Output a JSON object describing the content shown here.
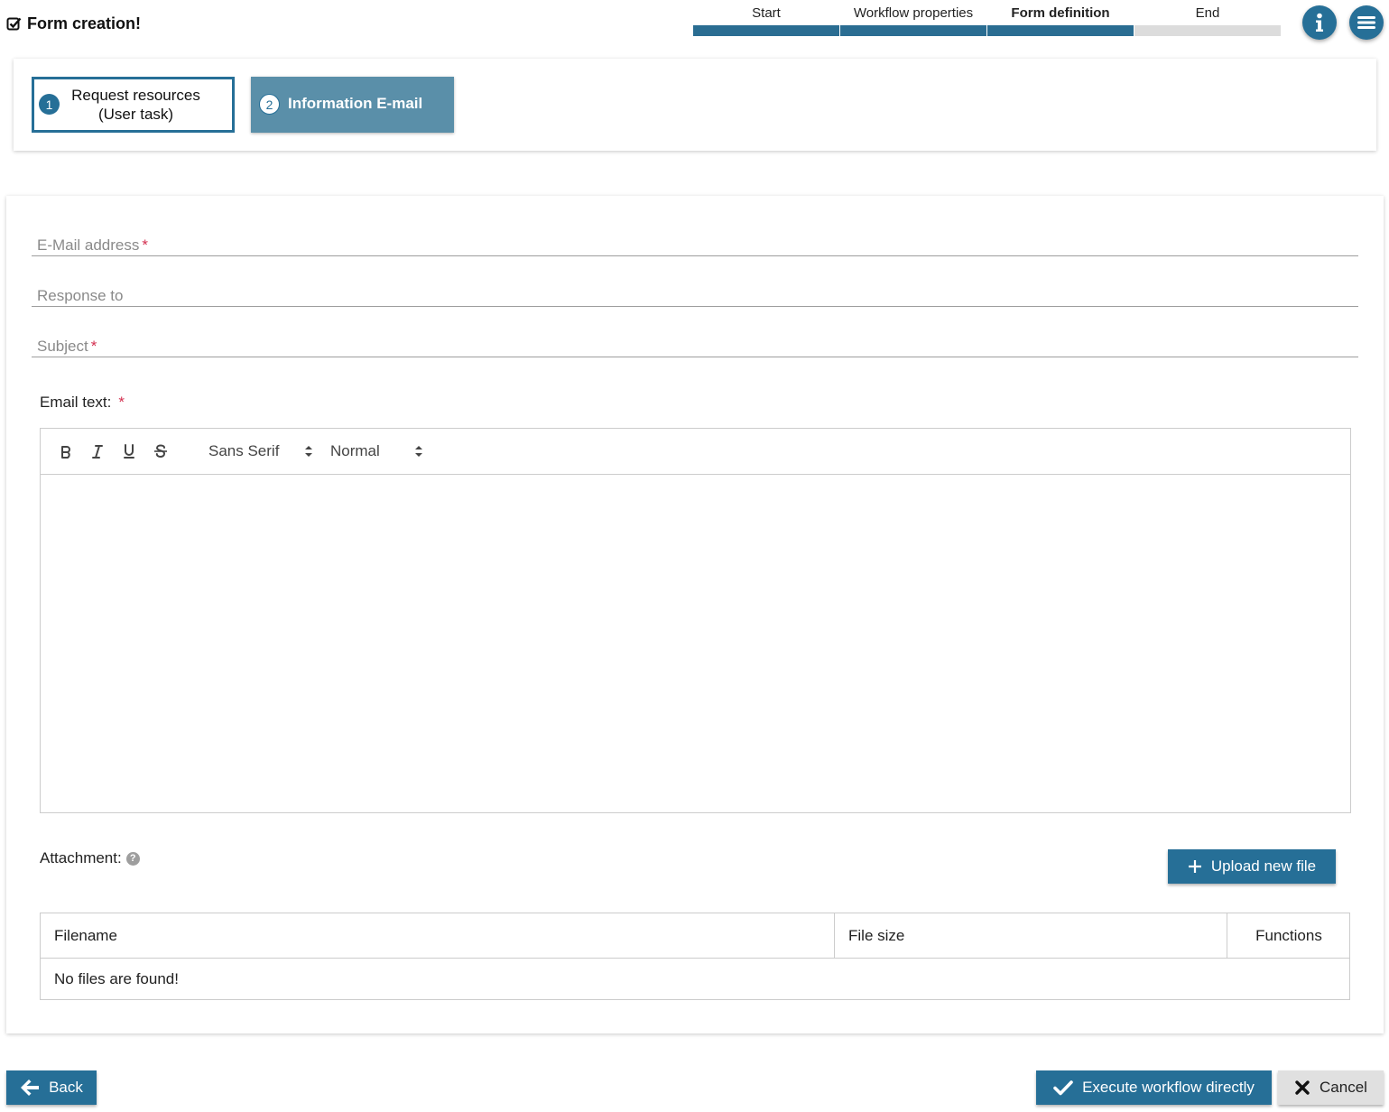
{
  "header": {
    "title": "Form creation!",
    "title_icon": "checkbox-icon",
    "steps": [
      {
        "label": "Start",
        "state": "done"
      },
      {
        "label": "Workflow properties",
        "state": "done"
      },
      {
        "label": "Form definition",
        "state": "current"
      },
      {
        "label": "End",
        "state": "todo"
      }
    ],
    "info_icon": "info-icon",
    "menu_icon": "menu-icon"
  },
  "tasks": [
    {
      "number": "1",
      "label": "Request resources (User task)",
      "line1": "Request resources",
      "line2": "(User task)",
      "selected": false
    },
    {
      "number": "2",
      "label": "Information E-mail",
      "selected": true
    }
  ],
  "form": {
    "email_address": {
      "label": "E-Mail address",
      "required_mark": "*",
      "value": ""
    },
    "response_to": {
      "label": "Response to",
      "value": ""
    },
    "subject": {
      "label": "Subject",
      "required_mark": "*",
      "value": ""
    },
    "email_text": {
      "label": "Email text:",
      "required_mark": "*",
      "toolbar": {
        "bold": "B",
        "italic": "I",
        "underline": "U",
        "strike": "S",
        "font": "Sans Serif",
        "size": "Normal"
      },
      "body": ""
    },
    "attachment": {
      "label": "Attachment:",
      "help": "?",
      "upload_label": "Upload new file",
      "columns": [
        "Filename",
        "File size",
        "Functions"
      ],
      "empty_text": "No files are found!"
    }
  },
  "footer": {
    "back_label": "Back",
    "execute_label": "Execute workflow directly",
    "cancel_label": "Cancel"
  },
  "colors": {
    "primary": "#266f97",
    "task_selected": "#5a8fa9",
    "required": "#d32f4f",
    "progress_todo": "#dcdcdc"
  }
}
